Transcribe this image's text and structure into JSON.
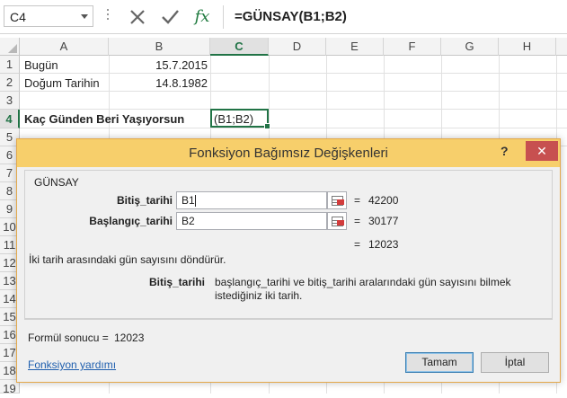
{
  "formula_bar": {
    "name_box": "C4",
    "formula": "=GÜNSAY(B1;B2)",
    "fx_label": "fx"
  },
  "grid": {
    "columns": [
      "A",
      "B",
      "C",
      "D",
      "E",
      "F",
      "G",
      "H"
    ],
    "active_column": "C",
    "rows": [
      "1",
      "2",
      "3",
      "4",
      "5",
      "6",
      "7",
      "8",
      "9",
      "10",
      "11",
      "12",
      "13",
      "14",
      "15",
      "16",
      "17",
      "18",
      "19"
    ],
    "active_row": "4",
    "cells": {
      "A1": "Bugün",
      "B1": "15.7.2015",
      "A2": "Doğum Tarihin",
      "B2": "14.8.1982",
      "A4": "Kaç Günden Beri Yaşıyorsun",
      "C4": "(B1;B2)"
    }
  },
  "dialog": {
    "title": "Fonksiyon Bağımsız Değişkenleri",
    "help": "?",
    "close": "✕",
    "function_name": "GÜNSAY",
    "args": [
      {
        "label": "Bitiş_tarihi",
        "value": "B1",
        "result": "42200"
      },
      {
        "label": "Başlangıç_tarihi",
        "value": "B2",
        "result": "30177"
      }
    ],
    "function_result": "12023",
    "equals": "=",
    "description": "İki tarih arasındaki gün sayısını döndürür.",
    "arg_help_label": "Bitiş_tarihi",
    "arg_help_text": "başlangıç_tarihi ve bitiş_tarihi aralarındaki gün sayısını bilmek istediğiniz iki tarih.",
    "formula_result_label": "Formül sonucu =",
    "formula_result_value": "12023",
    "help_link": "Fonksiyon yardımı",
    "ok": "Tamam",
    "cancel": "İptal"
  },
  "colors": {
    "excel_green": "#217346",
    "dialog_title": "#f7cf6b",
    "close_red": "#c75050",
    "link_blue": "#1f5fae"
  }
}
